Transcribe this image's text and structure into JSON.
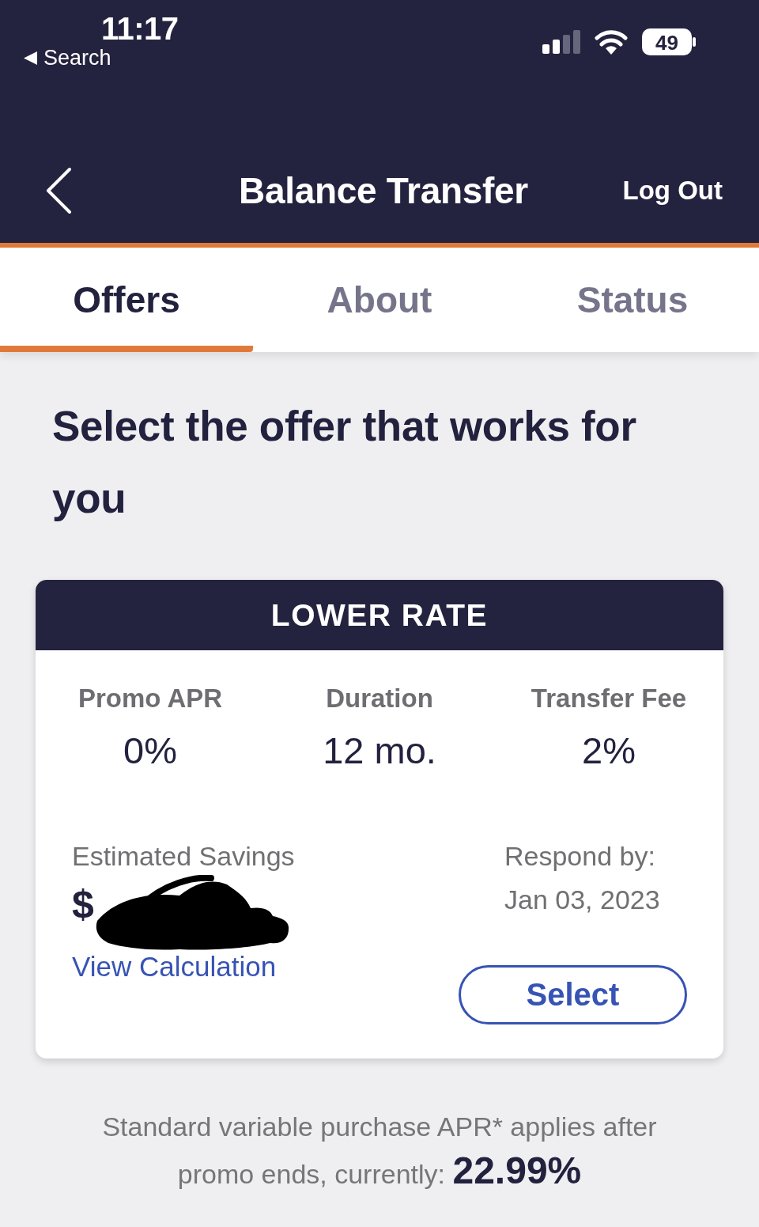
{
  "status_bar": {
    "time": "11:17",
    "back_label": "Search",
    "battery": "49"
  },
  "nav": {
    "title": "Balance Transfer",
    "action": "Log Out"
  },
  "tabs": [
    {
      "label": "Offers",
      "selected": true
    },
    {
      "label": "About",
      "selected": false
    },
    {
      "label": "Status",
      "selected": false
    }
  ],
  "heading": "Select the offer that works for you",
  "offer": {
    "title": "LOWER RATE",
    "terms": [
      {
        "label": "Promo APR",
        "value": "0%"
      },
      {
        "label": "Duration",
        "value": "12 mo."
      },
      {
        "label": "Transfer Fee",
        "value": "2%"
      }
    ],
    "savings": {
      "label": "Estimated Savings",
      "amount": "$",
      "redacted": true,
      "link": "View Calculation"
    },
    "respond_by": {
      "label": "Respond by:",
      "date": "Jan 03, 2023"
    },
    "button": "Select"
  },
  "footnote": "Standard variable purchase APR* applies after promo ends, currently: **22.99%**"
}
